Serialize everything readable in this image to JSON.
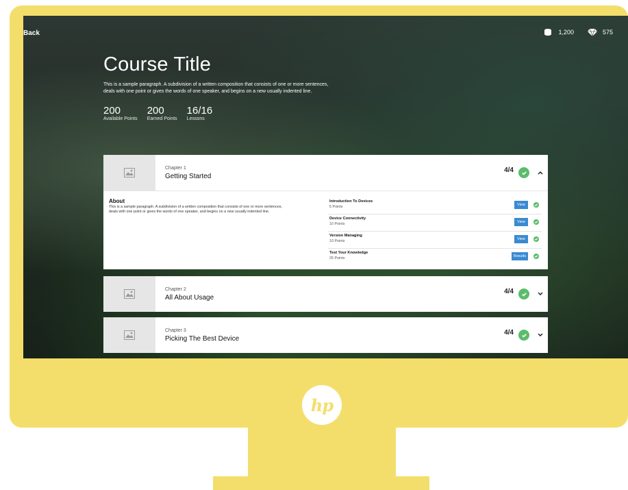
{
  "topbar": {
    "back_label": "Back",
    "stats": [
      {
        "icon": "coin-stack-icon",
        "value": "1,200"
      },
      {
        "icon": "diamond-icon",
        "value": "575"
      }
    ]
  },
  "course": {
    "title": "Course Title",
    "description": "This is a sample paragraph. A subdivision of a written composition that consists of one or more sentences, deals with one point or gives the words of one speaker, and begins on a new usually indented line.",
    "stats": [
      {
        "value": "200",
        "label": "Available Points"
      },
      {
        "value": "200",
        "label": "Earned Points"
      },
      {
        "value": "16/16",
        "label": "Lessons"
      }
    ]
  },
  "chapters": [
    {
      "number": "Chapter 1",
      "title": "Getting Started",
      "progress": "4/4",
      "expanded": true,
      "about_title": "About",
      "about_text": "This is a sample paragraph. A subdivision of a written composition that consists of one or more sentences, deals with one point or gives the words of one speaker, and begins on a new usually indented line.",
      "lessons": [
        {
          "title": "Introduction To Devices",
          "points": "5 Points",
          "button": "View"
        },
        {
          "title": "Device Connectivity",
          "points": "10 Points",
          "button": "View"
        },
        {
          "title": "Version Managing",
          "points": "10 Points",
          "button": "View"
        },
        {
          "title": "Test Your Knowledge",
          "points": "25 Points",
          "button": "Results"
        }
      ]
    },
    {
      "number": "Chapter 2",
      "title": "All About Usage",
      "progress": "4/4",
      "expanded": false
    },
    {
      "number": "Chapter 3",
      "title": "Picking The Best Device",
      "progress": "4/4",
      "expanded": false
    }
  ],
  "brand": {
    "logo_text": "hp"
  },
  "colors": {
    "frame": "#f4de6b",
    "accent_button": "#3a8ad1",
    "check_green": "#5cbc6c"
  }
}
